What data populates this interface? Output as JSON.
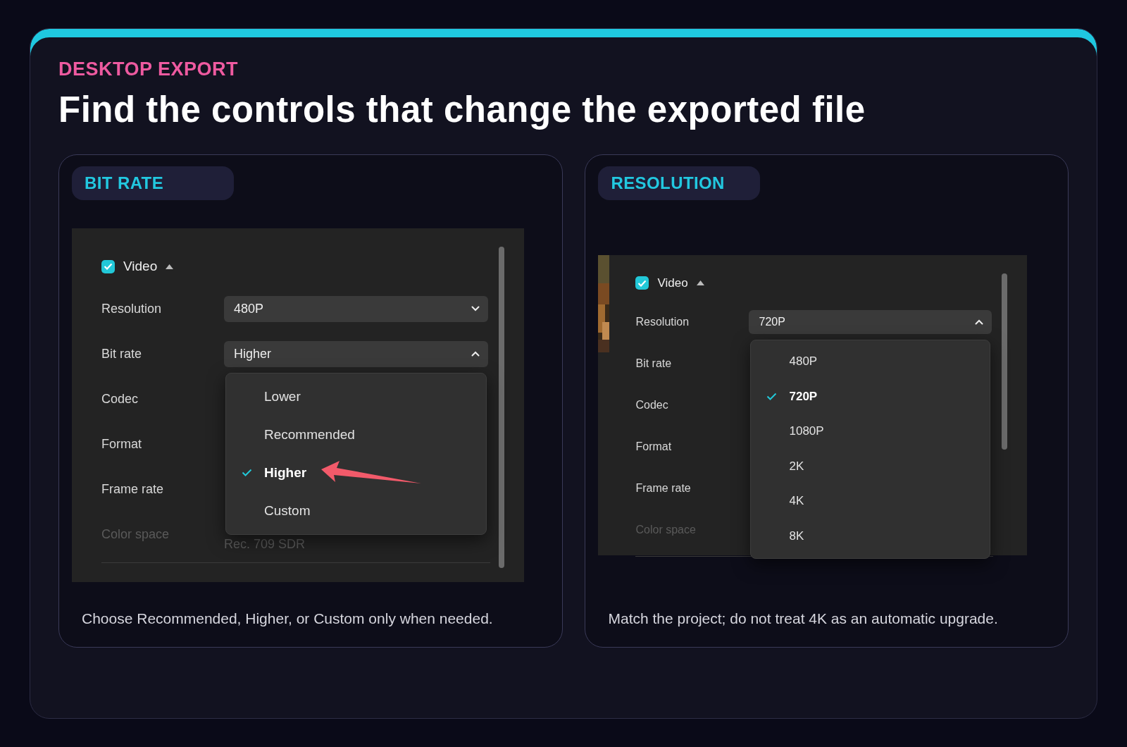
{
  "eyebrow": "DESKTOP EXPORT",
  "title": "Find the controls that change the exported file",
  "panels": [
    {
      "tag": "BIT RATE",
      "screen": {
        "picture_strip": false,
        "section": {
          "label": "Video",
          "checked": true
        },
        "rows": [
          {
            "label": "Resolution",
            "kind": "select",
            "value": "480P",
            "expanded": false
          },
          {
            "label": "Bit rate",
            "kind": "select",
            "value": "Higher",
            "expanded": true
          },
          {
            "label": "Codec",
            "kind": "label"
          },
          {
            "label": "Format",
            "kind": "label"
          },
          {
            "label": "Frame rate",
            "kind": "label"
          },
          {
            "label": "Color space",
            "kind": "text",
            "value": "Rec. 709 SDR",
            "disabled": true
          }
        ],
        "menu": {
          "pointer_arrow": true,
          "options": [
            {
              "label": "Lower",
              "selected": false
            },
            {
              "label": "Recommended",
              "selected": false
            },
            {
              "label": "Higher",
              "selected": true
            },
            {
              "label": "Custom",
              "selected": false
            }
          ]
        }
      },
      "caption": "Choose Recommended, Higher, or Custom only when needed."
    },
    {
      "tag": "RESOLUTION",
      "screen": {
        "picture_strip": true,
        "section": {
          "label": "Video",
          "checked": true
        },
        "rows": [
          {
            "label": "Resolution",
            "kind": "select",
            "value": "720P",
            "expanded": true
          },
          {
            "label": "Bit rate",
            "kind": "label"
          },
          {
            "label": "Codec",
            "kind": "label"
          },
          {
            "label": "Format",
            "kind": "label"
          },
          {
            "label": "Frame rate",
            "kind": "label"
          },
          {
            "label": "Color space",
            "kind": "label",
            "disabled": true
          }
        ],
        "menu": {
          "pointer_arrow": false,
          "options": [
            {
              "label": "480P",
              "selected": false
            },
            {
              "label": "720P",
              "selected": true
            },
            {
              "label": "1080P",
              "selected": false
            },
            {
              "label": "2K",
              "selected": false
            },
            {
              "label": "4K",
              "selected": false
            },
            {
              "label": "8K",
              "selected": false
            }
          ]
        }
      },
      "caption": "Match the project; do not treat 4K as an automatic upgrade."
    }
  ]
}
